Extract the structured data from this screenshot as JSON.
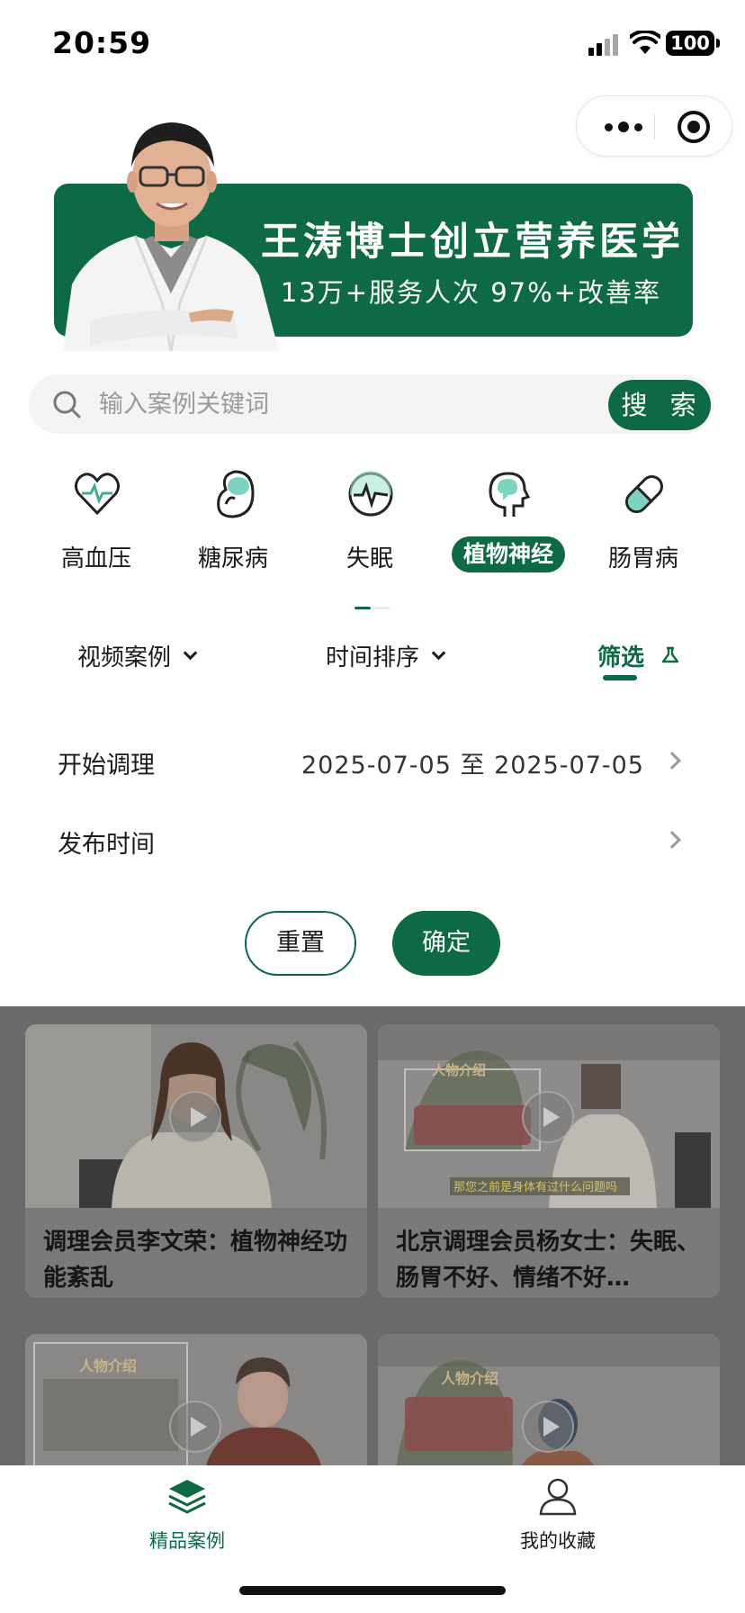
{
  "status_bar": {
    "time": "20:59",
    "battery": "100"
  },
  "banner": {
    "title": "王涛博士创立营养医学",
    "subtitle": "13万+服务人次  97%+改善率"
  },
  "search": {
    "placeholder": "输入案例关键词",
    "button_label": "搜 索"
  },
  "categories": [
    {
      "label": "高血压",
      "icon": "heart-pulse-icon",
      "active": false
    },
    {
      "label": "糖尿病",
      "icon": "kidney-icon",
      "active": false
    },
    {
      "label": "失眠",
      "icon": "pulse-circle-icon",
      "active": false
    },
    {
      "label": "植物神经",
      "icon": "brain-head-icon",
      "active": true
    },
    {
      "label": "肠胃病",
      "icon": "capsule-icon",
      "active": false
    }
  ],
  "filters": {
    "type_label": "视频案例",
    "sort_label": "时间排序",
    "filter_label": "筛选"
  },
  "filter_panel": {
    "start_label": "开始调理",
    "start_value": "2025-07-05 至 2025-07-05",
    "publish_label": "发布时间",
    "publish_value": "",
    "reset_label": "重置",
    "confirm_label": "确定"
  },
  "cases": [
    {
      "title": "调理会员李文荣：植物神经功能紊乱"
    },
    {
      "title": "北京调理会员杨女士：失眠、肠胃不好、情绪不好…"
    },
    {
      "title": ""
    },
    {
      "title": ""
    }
  ],
  "thumb_captions": {
    "intro_heading": "人物介绍",
    "subtitle_text": "那您之前是身体有过什么问题吗"
  },
  "tabbar": {
    "cases_label": "精品案例",
    "favorites_label": "我的收藏"
  },
  "colors": {
    "brand_green": "#0d6a45",
    "overlay": "#6a6a6a"
  }
}
